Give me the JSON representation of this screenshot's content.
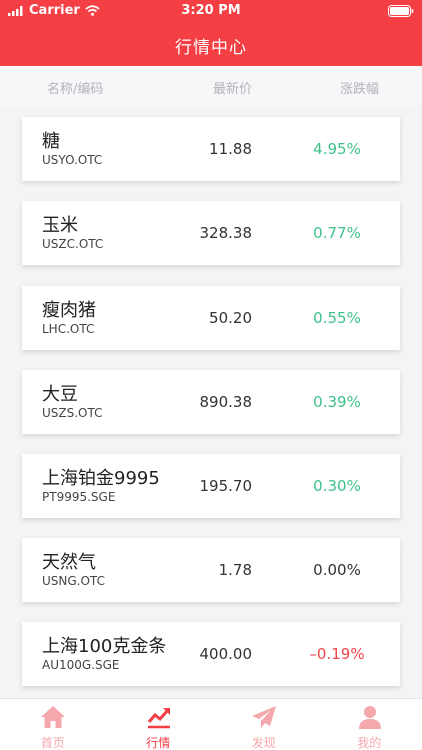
{
  "status_bar": {
    "carrier": "Carrier",
    "time": "3:20 PM"
  },
  "header": {
    "title": "行情中心"
  },
  "columns": {
    "name": "名称/编码",
    "price": "最新价",
    "change": "涨跌幅"
  },
  "colors": {
    "accent": "#f43f45",
    "up": "#3fc28a",
    "down": "#f0434b",
    "flat": "#333333",
    "tab_inactive": "#f4a8ab"
  },
  "quotes": [
    {
      "name": "糖",
      "code": "USYO.OTC",
      "price": "11.88",
      "change": "4.95%",
      "trend": "up"
    },
    {
      "name": "玉米",
      "code": "USZC.OTC",
      "price": "328.38",
      "change": "0.77%",
      "trend": "up"
    },
    {
      "name": "瘦肉猪",
      "code": "LHC.OTC",
      "price": "50.20",
      "change": "0.55%",
      "trend": "up"
    },
    {
      "name": "大豆",
      "code": "USZS.OTC",
      "price": "890.38",
      "change": "0.39%",
      "trend": "up"
    },
    {
      "name": "上海铂金9995",
      "code": "PT9995.SGE",
      "price": "195.70",
      "change": "0.30%",
      "trend": "up"
    },
    {
      "name": "天然气",
      "code": "USNG.OTC",
      "price": "1.78",
      "change": "0.00%",
      "trend": "flat"
    },
    {
      "name": "上海100克金条",
      "code": "AU100G.SGE",
      "price": "400.00",
      "change": "–0.19%",
      "trend": "down"
    }
  ],
  "tabs": [
    {
      "label": "首页",
      "icon": "home-icon",
      "active": false
    },
    {
      "label": "行情",
      "icon": "chart-icon",
      "active": true
    },
    {
      "label": "发现",
      "icon": "send-icon",
      "active": false
    },
    {
      "label": "我的",
      "icon": "user-icon",
      "active": false
    }
  ]
}
